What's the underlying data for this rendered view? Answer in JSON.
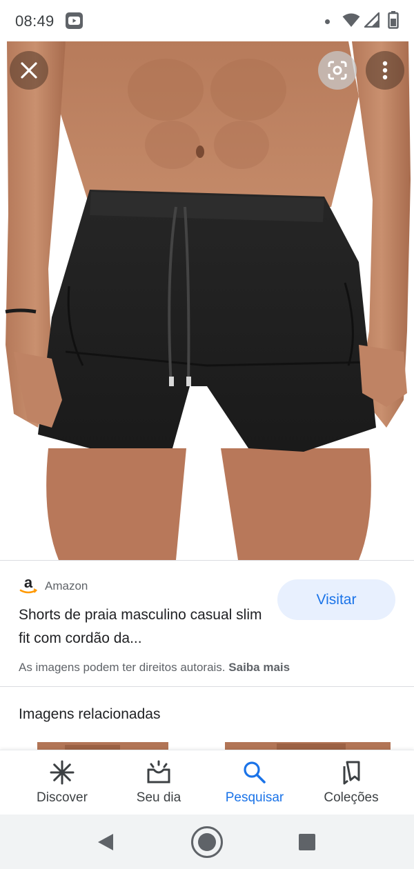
{
  "status_bar": {
    "time": "08:49",
    "icons": [
      "youtube-icon",
      "notification-dot-icon",
      "wifi-icon",
      "cell-signal-icon",
      "battery-icon"
    ]
  },
  "viewer": {
    "close_icon": "close-icon",
    "lens_icon": "google-lens-icon",
    "more_icon": "more-vert-icon",
    "photo_description_icon": "shorts-product-photo"
  },
  "result": {
    "source": "Amazon",
    "source_logo": "amazon-logo",
    "title": "Shorts de praia masculino casual slim fit com cordão da...",
    "visit_label": "Visitar",
    "copyright_text": "As imagens podem ter direitos autorais.",
    "learn_more_label": "Saiba mais"
  },
  "related": {
    "heading": "Imagens relacionadas"
  },
  "bottom_nav": {
    "items": [
      {
        "label": "Discover",
        "icon": "discover-asterisk-icon"
      },
      {
        "label": "Seu dia",
        "icon": "sunrise-icon"
      },
      {
        "label": "Pesquisar",
        "icon": "search-icon"
      },
      {
        "label": "Coleções",
        "icon": "collections-bookmark-icon"
      }
    ],
    "active_color": "#1a73e8",
    "inactive_color": "#3c4043"
  },
  "system_nav": {
    "icons": [
      "back-triangle-icon",
      "home-circle-icon",
      "recents-square-icon"
    ]
  }
}
